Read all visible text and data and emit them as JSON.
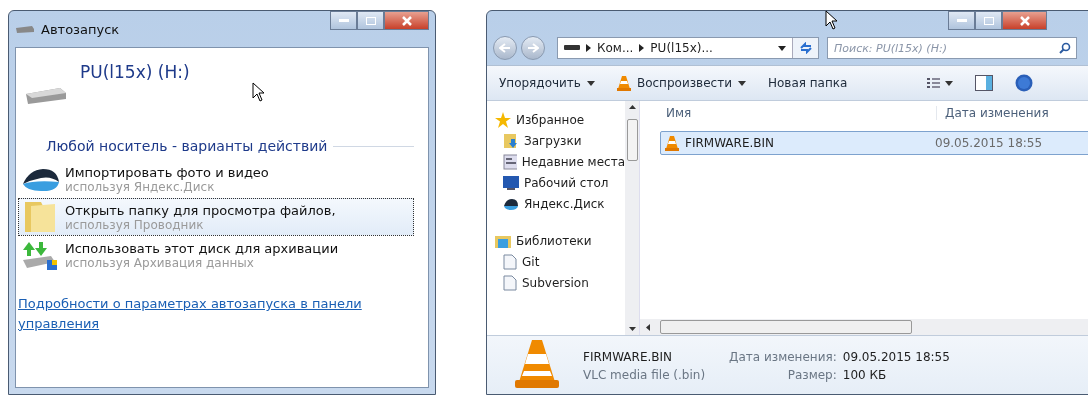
{
  "autoplay": {
    "title": "Автозапуск",
    "device": "PU(l15x) (H:)",
    "section": "Любой носитель - варианты действий",
    "actions": [
      {
        "kind": "cloud",
        "title": "Импортировать фото и видео",
        "subtitle": "используя Яндекс.Диск",
        "selected": false
      },
      {
        "kind": "folder",
        "title": "Открыть папку для просмотра файлов,",
        "subtitle": "используя Проводник",
        "selected": true
      },
      {
        "kind": "backup",
        "title": "Использовать этот диск для архивации",
        "subtitle": "используя Архивация данных",
        "selected": false
      }
    ],
    "link": "Подробности о параметрах автозапуска в панели управления"
  },
  "explorer": {
    "breadcrumbs": [
      "Ком...",
      "PU(l15x)..."
    ],
    "search": {
      "placeholder": "Поиск: PU(l15x) (H:)"
    },
    "toolbar": [
      {
        "kind": "menu",
        "label": "Упорядочить"
      },
      {
        "kind": "vlc-menu",
        "label": "Воспроизвести"
      },
      {
        "kind": "plain",
        "label": "Новая папка"
      }
    ],
    "sidebar": {
      "items": [
        {
          "kind": "star",
          "label": "Избранное",
          "children": [
            {
              "kind": "download",
              "label": "Загрузки"
            },
            {
              "kind": "recent",
              "label": "Недавние места"
            },
            {
              "kind": "desktop",
              "label": "Рабочий стол"
            },
            {
              "kind": "cloud",
              "label": "Яндекс.Диск"
            }
          ]
        },
        {
          "kind": "library",
          "label": "Библиотеки",
          "children": [
            {
              "kind": "doc",
              "label": "Git"
            },
            {
              "kind": "doc",
              "label": "Subversion"
            }
          ]
        }
      ]
    },
    "columns": [
      "Имя",
      "Дата изменения"
    ],
    "files": [
      {
        "name": "FIRMWARE.BIN",
        "date": "09.05.2015 18:55",
        "selected": true
      }
    ],
    "details": {
      "name": "FIRMWARE.BIN",
      "type": "VLC media file (.bin)",
      "fields": [
        {
          "label": "Дата изменения:",
          "value": "09.05.2015 18:55"
        },
        {
          "label": "Размер:",
          "value": "100 КБ"
        }
      ]
    }
  }
}
